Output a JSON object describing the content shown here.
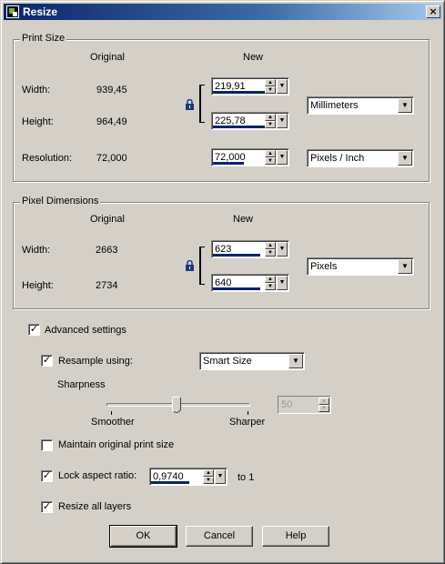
{
  "window": {
    "title": "Resize"
  },
  "print_size": {
    "group_label": "Print Size",
    "col_original": "Original",
    "col_new": "New",
    "width_label": "Width:",
    "width_original": "939,45",
    "width_new": "219,91",
    "height_label": "Height:",
    "height_original": "964,49",
    "height_new": "225,78",
    "units": "Millimeters",
    "resolution_label": "Resolution:",
    "resolution_original": "72,000",
    "resolution_new": "72,000",
    "resolution_units": "Pixels / Inch"
  },
  "pixel_dimensions": {
    "group_label": "Pixel Dimensions",
    "col_original": "Original",
    "col_new": "New",
    "width_label": "Width:",
    "width_original": "2663",
    "width_new": "623",
    "height_label": "Height:",
    "height_original": "2734",
    "height_new": "640",
    "units": "Pixels"
  },
  "advanced": {
    "advanced_label": "Advanced settings",
    "advanced_checked": true,
    "resample_label": "Resample using:",
    "resample_checked": true,
    "resample_method": "Smart Size",
    "sharpness_label": "Sharpness",
    "smoother_label": "Smoother",
    "sharper_label": "Sharper",
    "sharpness_value": "50",
    "maintain_label": "Maintain original print size",
    "maintain_checked": false,
    "lock_aspect_label": "Lock aspect ratio:",
    "lock_aspect_checked": true,
    "aspect_value": "0,9740",
    "to_one_label": "to 1",
    "resize_layers_label": "Resize all layers",
    "resize_layers_checked": true
  },
  "buttons": {
    "ok": "OK",
    "cancel": "Cancel",
    "help": "Help"
  },
  "colors": {
    "titlebar_start": "#0a246a",
    "titlebar_end": "#a6caf0",
    "dialog_bg": "#d4d0c8"
  }
}
